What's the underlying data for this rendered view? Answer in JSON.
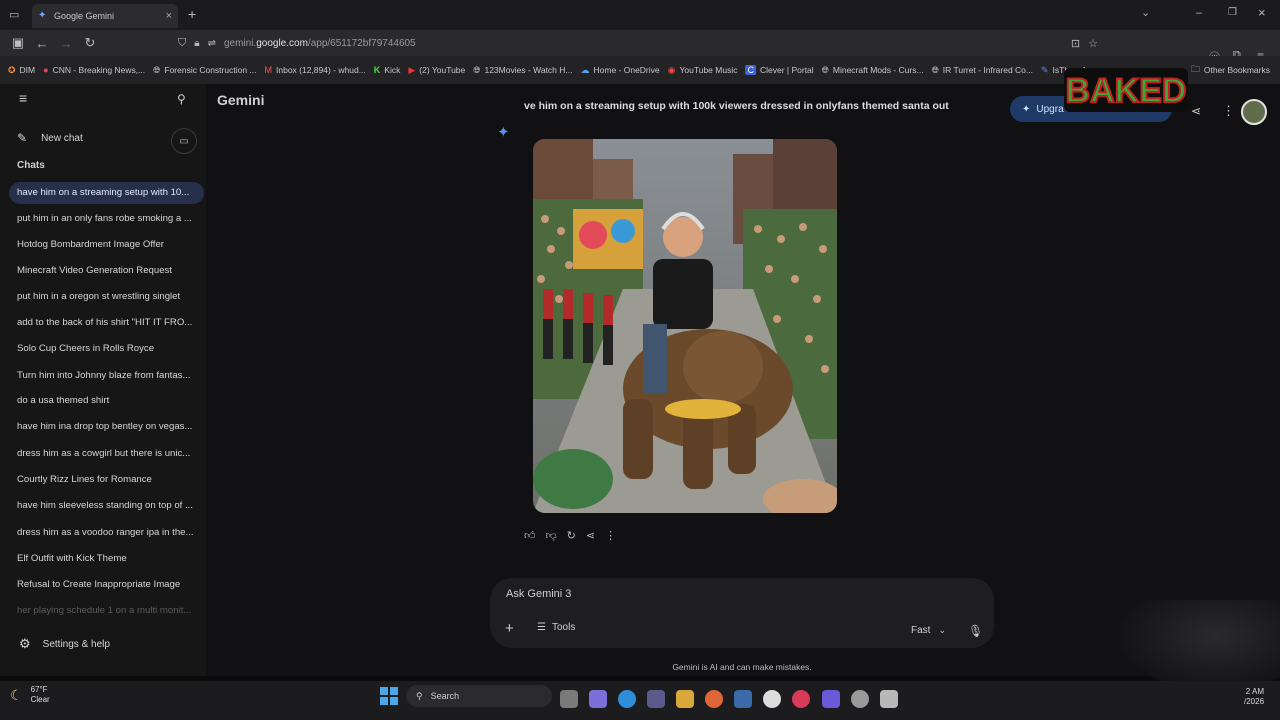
{
  "browser": {
    "tab_title": "Google Gemini",
    "url_prefix": "gemini.",
    "url_domain": "google.com",
    "url_path": "/app/651172bf79744605",
    "bookmarks": [
      {
        "label": "DIM",
        "icon": "dim-icon"
      },
      {
        "label": "CNN - Breaking News,...",
        "icon": "cnn-icon"
      },
      {
        "label": "Forensic Construction ...",
        "icon": "globe-icon"
      },
      {
        "label": "Inbox (12,894) - whud...",
        "icon": "gmail-icon"
      },
      {
        "label": "Kick",
        "icon": "kick-icon"
      },
      {
        "label": "(2) YouTube",
        "icon": "youtube-icon"
      },
      {
        "label": "123Movies - Watch H...",
        "icon": "globe-icon"
      },
      {
        "label": "Home - OneDrive",
        "icon": "onedrive-icon"
      },
      {
        "label": "YouTube Music",
        "icon": "youtube-music-icon"
      },
      {
        "label": "Clever | Portal",
        "icon": "clever-icon"
      },
      {
        "label": "Minecraft Mods - Curs...",
        "icon": "globe-icon"
      },
      {
        "label": "IR Turret - Infrared Co...",
        "icon": "globe-icon"
      },
      {
        "label": "IsThereAny",
        "icon": "globe-icon"
      }
    ],
    "other_bookmarks": "Other Bookmarks"
  },
  "sidebar": {
    "new_chat": "New chat",
    "chats_heading": "Chats",
    "chats": [
      "have him on a streaming setup with 10...",
      "put him in an only fans robe smoking a ...",
      "Hotdog Bombardment Image Offer",
      "Minecraft Video Generation Request",
      "put him in a oregon st wrestling singlet",
      "add to the back of his shirt \"HIT IT FRO...",
      "Solo Cup Cheers in Rolls Royce",
      "Turn him into Johnny blaze from fantas...",
      "do a usa themed shirt",
      "have him ina drop top bentley on vegas...",
      "dress him as a cowgirl but there is unic...",
      "Courtly Rizz Lines for Romance",
      "have him sleeveless standing on top of ...",
      "dress him as a voodoo ranger ipa in the...",
      "Elf Outfit with Kick Theme",
      "Refusal to Create Inappropriate Image",
      "her playing schedule 1 on a multi monit..."
    ],
    "active_index": 0,
    "settings": "Settings & help"
  },
  "main": {
    "brand": "Gemini",
    "prompt": "ve him on a streaming setup with 100k viewers dressed in onlyfans themed santa out",
    "upgrade_label": "Upgra",
    "input_placeholder": "Ask Gemini 3",
    "tools_label": "Tools",
    "model_label": "Fast",
    "disclaimer": "Gemini is AI and can make mistakes."
  },
  "taskbar": {
    "weather_temp": "67°F",
    "weather_cond": "Clear",
    "search_placeholder": "Search",
    "clock_time": "2 AM",
    "clock_date": "/2026"
  },
  "overlay": {
    "logo_text": "BAKED"
  },
  "colors": {
    "accent": "#5b8def",
    "active_chat_bg": "#27304a",
    "upgrade_bg": "#1f3a67"
  }
}
